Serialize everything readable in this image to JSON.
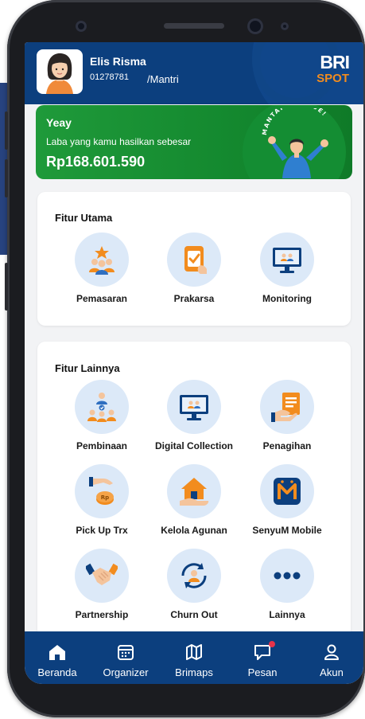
{
  "user": {
    "name": "Elis Risma",
    "id": "01278781",
    "role": "/Mantri"
  },
  "logo": {
    "line1": "BRI",
    "line2": "SPOT"
  },
  "banner": {
    "title": "Yeay",
    "subtitle": "Laba yang kamu hasilkan sebesar",
    "amount": "Rp168.601.590",
    "mascot_text": "MANTAP BOSQUE!"
  },
  "fitur_utama": {
    "title": "Fitur Utama",
    "items": [
      {
        "label": "Pemasaran",
        "icon": "marketing-icon"
      },
      {
        "label": "Prakarsa",
        "icon": "checklist-icon"
      },
      {
        "label": "Monitoring",
        "icon": "monitor-icon"
      }
    ]
  },
  "fitur_lainnya": {
    "title": "Fitur Lainnya",
    "items": [
      {
        "label": "Pembinaan",
        "icon": "coaching-icon"
      },
      {
        "label": "Digital Collection",
        "icon": "digital-collection-icon"
      },
      {
        "label": "Penagihan",
        "icon": "billing-icon"
      },
      {
        "label": "Pick Up Trx",
        "icon": "pickup-transaction-icon"
      },
      {
        "label": "Kelola Agunan",
        "icon": "collateral-icon"
      },
      {
        "label": "SenyuM Mobile",
        "icon": "senyum-mobile-icon"
      },
      {
        "label": "Partnership",
        "icon": "handshake-icon"
      },
      {
        "label": "Churn Out",
        "icon": "churn-out-icon"
      },
      {
        "label": "Lainnya",
        "icon": "more-icon"
      }
    ]
  },
  "nav": [
    {
      "label": "Beranda",
      "icon": "home-icon"
    },
    {
      "label": "Organizer",
      "icon": "calendar-icon"
    },
    {
      "label": "Brimaps",
      "icon": "map-icon"
    },
    {
      "label": "Pesan",
      "icon": "message-icon"
    },
    {
      "label": "Akun",
      "icon": "account-icon"
    }
  ],
  "colors": {
    "primary": "#0c3f7e",
    "accent": "#f28c1e",
    "banner": "#1f9a3a",
    "icon_bg": "#dce9f8"
  }
}
